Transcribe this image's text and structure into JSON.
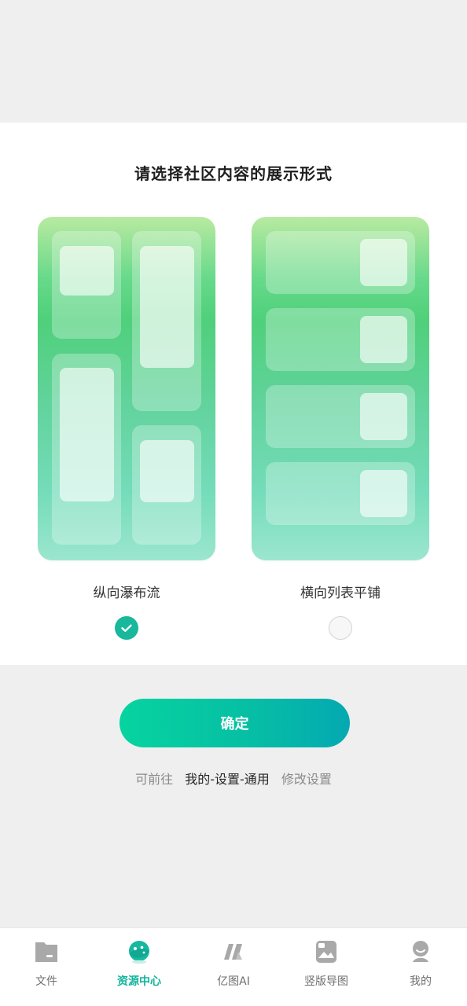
{
  "header": {
    "title": "请选择社区内容的展示形式"
  },
  "options": [
    {
      "label": "纵向瀑布流",
      "selected": true
    },
    {
      "label": "横向列表平铺",
      "selected": false
    }
  ],
  "actions": {
    "confirm_label": "确定"
  },
  "hint": {
    "prefix": "可前往",
    "path": "我的-设置-通用",
    "suffix": "修改设置"
  },
  "tabbar": {
    "items": [
      {
        "label": "文件",
        "icon": "folder-icon",
        "active": false
      },
      {
        "label": "资源中心",
        "icon": "planet-icon",
        "active": true
      },
      {
        "label": "亿图AI",
        "icon": "edraw-ai-icon",
        "active": false
      },
      {
        "label": "竖版导图",
        "icon": "ai-image-icon",
        "active": false
      },
      {
        "label": "我的",
        "icon": "user-icon",
        "active": false
      }
    ]
  },
  "colors": {
    "accent": "#13b49c",
    "button_gradient_start": "#06d4a0",
    "button_gradient_end": "#04a9b1",
    "card_gradient_top": "#b8eaa1",
    "card_gradient_mid": "#4fd07b",
    "card_gradient_bottom": "#9be6ce"
  }
}
